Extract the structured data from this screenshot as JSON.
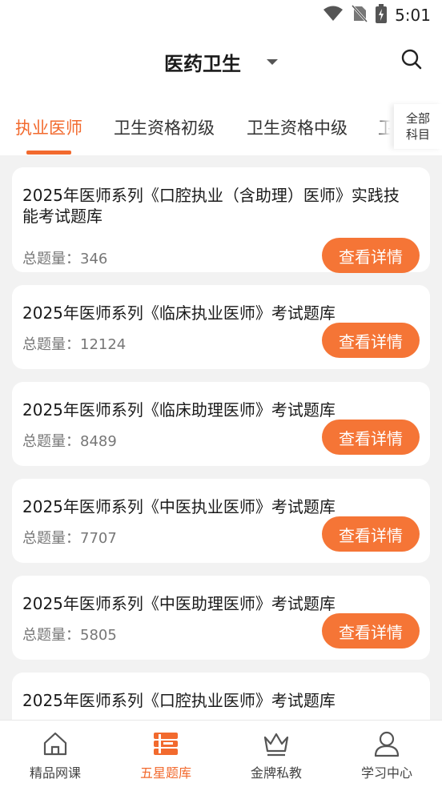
{
  "status_bar": {
    "time": "5:01"
  },
  "header": {
    "title": "医药卫生"
  },
  "tabs": [
    "执业医师",
    "卫生资格初级",
    "卫生资格中级",
    "卫"
  ],
  "all_subjects": {
    "line1": "全部",
    "line2": "科目"
  },
  "cards": [
    {
      "title": "2025年医师系列《口腔执业（含助理）医师》实践技能考试题库",
      "count_label": "总题量：",
      "count": "346",
      "button": "查看详情"
    },
    {
      "title": "2025年医师系列《临床执业医师》考试题库",
      "count_label": "总题量：",
      "count": "12124",
      "button": "查看详情"
    },
    {
      "title": "2025年医师系列《临床助理医师》考试题库",
      "count_label": "总题量：",
      "count": "8489",
      "button": "查看详情"
    },
    {
      "title": "2025年医师系列《中医执业医师》考试题库",
      "count_label": "总题量：",
      "count": "7707",
      "button": "查看详情"
    },
    {
      "title": "2025年医师系列《中医助理医师》考试题库",
      "count_label": "总题量：",
      "count": "5805",
      "button": "查看详情"
    },
    {
      "title": "2025年医师系列《口腔执业医师》考试题库"
    }
  ],
  "bottom_nav": [
    {
      "label": "精品网课",
      "icon": "home-icon"
    },
    {
      "label": "五星题库",
      "icon": "question-bank-icon"
    },
    {
      "label": "金牌私教",
      "icon": "crown-icon"
    },
    {
      "label": "学习中心",
      "icon": "person-icon"
    }
  ],
  "colors": {
    "accent": "#f26a2e",
    "button": "#f57536"
  }
}
